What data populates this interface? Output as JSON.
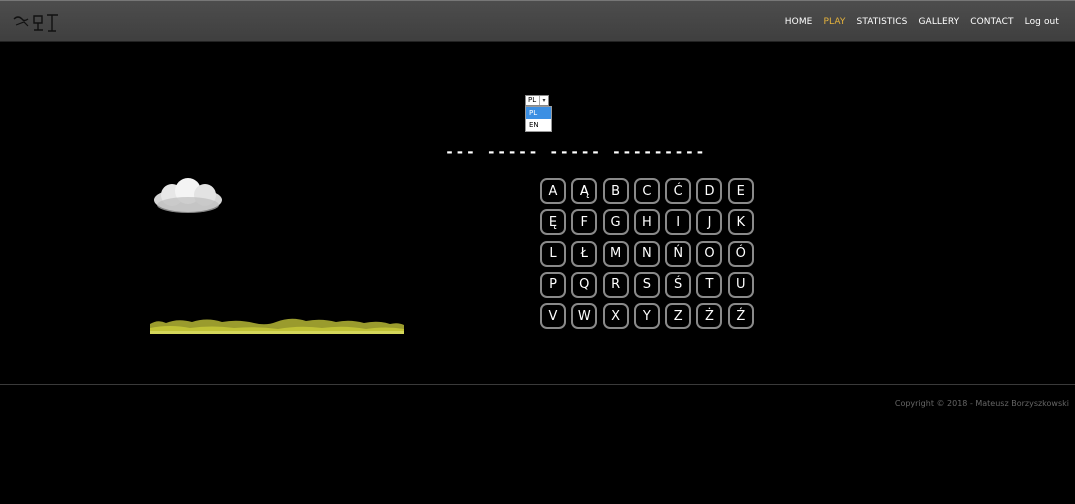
{
  "nav": {
    "items": [
      {
        "label": "HOME",
        "active": false
      },
      {
        "label": "PLAY",
        "active": true
      },
      {
        "label": "STATISTICS",
        "active": false
      },
      {
        "label": "GALLERY",
        "active": false
      },
      {
        "label": "CONTACT",
        "active": false
      },
      {
        "label": "Log out",
        "active": false
      }
    ],
    "active_color": "#e6b33c"
  },
  "language": {
    "selected": "PL",
    "options": [
      "PL",
      "EN"
    ],
    "highlight_color": "#3b8fe3"
  },
  "game": {
    "password_mask": "--- ----- ----- ---------",
    "letters": [
      "A",
      "Ą",
      "B",
      "C",
      "Ć",
      "D",
      "E",
      "Ę",
      "F",
      "G",
      "H",
      "I",
      "J",
      "K",
      "L",
      "Ł",
      "M",
      "N",
      "Ń",
      "O",
      "Ó",
      "P",
      "Q",
      "R",
      "S",
      "Ś",
      "T",
      "U",
      "V",
      "W",
      "X",
      "Y",
      "Z",
      "Ż",
      "Ź"
    ]
  },
  "footer": {
    "copyright": "Copyright © 2018 - Mateusz Borzyszkowski"
  }
}
